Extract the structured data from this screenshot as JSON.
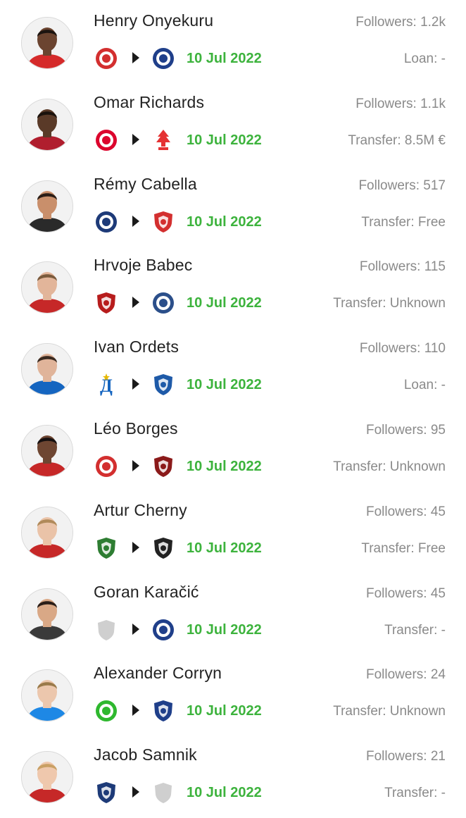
{
  "transfers": [
    {
      "player": "Henry Onyekuru",
      "followers": "Followers: 1.2k",
      "from_club_icon": "olympiacos-crest",
      "to_club_icon": "adana-demirspor-crest",
      "date": "10 Jul 2022",
      "transfer_type": "Loan: -",
      "skin": "#6b4430",
      "hair": "#1c1410",
      "shirt": "#d52a2a",
      "from_color": "#d32f2f",
      "to_color": "#1f3f8a"
    },
    {
      "player": "Omar Richards",
      "followers": "Followers: 1.1k",
      "from_club_icon": "bayern-munich-crest",
      "to_club_icon": "nottingham-forest-crest",
      "date": "10 Jul 2022",
      "transfer_type": "Transfer: 8.5M €",
      "skin": "#5a3a28",
      "hair": "#1a120d",
      "shirt": "#b01e2e",
      "from_color": "#dc052d",
      "to_color": "#e53233"
    },
    {
      "player": "Rémy Cabella",
      "followers": "Followers: 517",
      "from_club_icon": "montpellier-crest",
      "to_club_icon": "lille-crest",
      "date": "10 Jul 2022",
      "transfer_type": "Transfer: Free",
      "skin": "#c98f6b",
      "hair": "#2a1d16",
      "shirt": "#2a2a2a",
      "from_color": "#1d3a78",
      "to_color": "#d32f2f"
    },
    {
      "player": "Hrvoje Babec",
      "followers": "Followers: 115",
      "from_club_icon": "gorica-crest",
      "to_club_icon": "rizespor-crest",
      "date": "10 Jul 2022",
      "transfer_type": "Transfer: Unknown",
      "skin": "#e2b59a",
      "hair": "#7a5a3c",
      "shirt": "#c62828",
      "from_color": "#b71c1c",
      "to_color": "#2b4f8a"
    },
    {
      "player": "Ivan Ordets",
      "followers": "Followers: 110",
      "from_club_icon": "dynamo-moscow-crest",
      "to_club_icon": "vfl-bochum-crest",
      "date": "10 Jul 2022",
      "transfer_type": "Loan: -",
      "skin": "#e0b49a",
      "hair": "#3a2a20",
      "shirt": "#1565c0",
      "from_color": "#1565c0",
      "to_color": "#1e5aa8"
    },
    {
      "player": "Léo Borges",
      "followers": "Followers: 95",
      "from_club_icon": "internacional-crest",
      "to_club_icon": "pogon-szczecin-crest",
      "date": "10 Jul 2022",
      "transfer_type": "Transfer: Unknown",
      "skin": "#6e4632",
      "hair": "#161010",
      "shirt": "#c62828",
      "from_color": "#d32f2f",
      "to_color": "#8b1a1a"
    },
    {
      "player": "Artur Cherny",
      "followers": "Followers: 45",
      "from_club_icon": "lokomotiv-moscow-crest",
      "to_club_icon": "khimki-crest",
      "date": "10 Jul 2022",
      "transfer_type": "Transfer: Free",
      "skin": "#eac3a8",
      "hair": "#b08a5a",
      "shirt": "#c62828",
      "from_color": "#2e7d32",
      "to_color": "#222222"
    },
    {
      "player": "Goran Karačić",
      "followers": "Followers: 45",
      "from_club_icon": "unknown-club-crest",
      "to_club_icon": "adana-demirspor-crest",
      "date": "10 Jul 2022",
      "transfer_type": "Transfer: -",
      "skin": "#d9a886",
      "hair": "#2a1e18",
      "shirt": "#3a3a3a",
      "from_color": "#cfcfcf",
      "to_color": "#1f3f8a"
    },
    {
      "player": "Alexander Corryn",
      "followers": "Followers: 24",
      "from_club_icon": "lommel-crest",
      "to_club_icon": "westerlo-crest",
      "date": "10 Jul 2022",
      "transfer_type": "Transfer: Unknown",
      "skin": "#ecc7ad",
      "hair": "#9a7a4a",
      "shirt": "#1e88e5",
      "from_color": "#2eb82e",
      "to_color": "#1f3f8a"
    },
    {
      "player": "Jacob Samnik",
      "followers": "Followers: 21",
      "from_club_icon": "hacken-crest",
      "to_club_icon": "unknown-club-crest",
      "date": "10 Jul 2022",
      "transfer_type": "Transfer: -",
      "skin": "#efc8ad",
      "hair": "#c9a064",
      "shirt": "#c62828",
      "from_color": "#1d3a78",
      "to_color": "#cfcfcf"
    }
  ]
}
